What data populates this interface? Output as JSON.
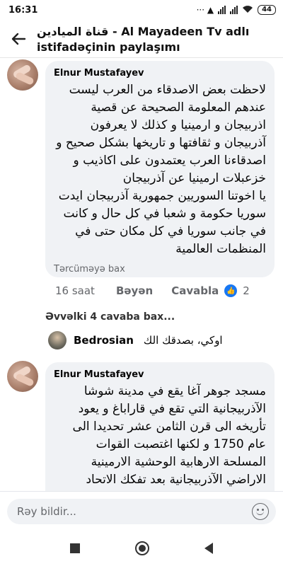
{
  "status_bar": {
    "time": "16:31",
    "icons": "··· ▲",
    "battery": "44"
  },
  "header": {
    "title": "قناة الميادين - Al Mayadeen Tv adlı istifadəçinin paylaşımı"
  },
  "comments": [
    {
      "author": "Elnur Mustafayev",
      "text": "لاحظت بعض الاصدقاء من العرب ليست عندهم المعلومة الصحيحة عن قصية اذربيجان و ارمينيا و كذلك لا يعرفون آذربيجان و ثقافتها و تاريخها بشكل صحيح و اصدقاءنا العرب يعتمدون على اكاذيب و خزعبلات ارمينيا عن آذربيجان\nيا اخوتنا السوريين جمهورية آذربيجان ايدت سوريا حكومة و شعبا في كل حال و كانت في جانب سوريا في كل مكان حتى في المنظمات العالمية",
      "translation": "Tərcüməyə bax",
      "time": "16 saat",
      "like": "Bəyən",
      "reply": "Cavabla",
      "likes": "2"
    },
    {
      "author": "Elnur Mustafayev",
      "text": "مسجد جوهر آغا يقع في مدينة شوشا الآذربيجانية التي تقع في قاراباغ و يعود تأريخه الى قرن الثامن عشر تحديدا الى عام 1750 و لكنها اغتصبت القوات المسلحة الارهابية الوحشية الارمينية الاراضي الآذربيجانية بعد تفكك الاتحاد السوفيتي"
    }
  ],
  "view_previous": "Əvvəlki 4 cavaba bax...",
  "reply": {
    "author": "Bedrosian",
    "text": "اوكي، بصدقك الك"
  },
  "comment_input": {
    "placeholder": "Rəy bildir..."
  }
}
